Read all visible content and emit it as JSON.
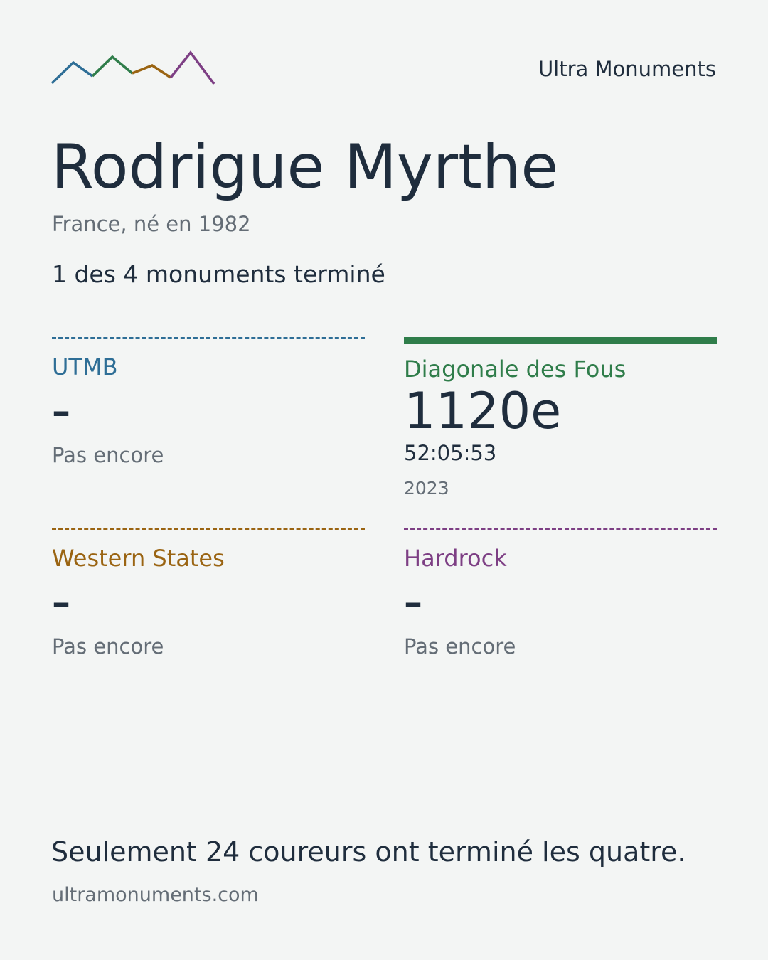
{
  "brand": "Ultra Monuments",
  "runner": {
    "name": "Rodrigue Myrthe",
    "origin": "France, né en 1982",
    "progress": "1 des 4 monuments terminé"
  },
  "races": [
    {
      "name": "UTMB",
      "color": "#2e6e96",
      "completed": false,
      "result": "–",
      "status": "Pas encore"
    },
    {
      "name": "Diagonale des Fous",
      "color": "#2f7d4a",
      "completed": true,
      "rank": "1120e",
      "time": "52:05:53",
      "year": "2023"
    },
    {
      "name": "Western States",
      "color": "#9a6412",
      "completed": false,
      "result": "–",
      "status": "Pas encore"
    },
    {
      "name": "Hardrock",
      "color": "#7d3f84",
      "completed": false,
      "result": "–",
      "status": "Pas encore"
    }
  ],
  "footer": {
    "note": "Seulement 24 coureurs ont terminé les quatre.",
    "site": "ultramonuments.com"
  },
  "logo": {
    "icon": "mountain-ridge-logo",
    "colors": [
      "#2e6e96",
      "#2f7d4a",
      "#9a6412",
      "#7d3f84"
    ]
  }
}
